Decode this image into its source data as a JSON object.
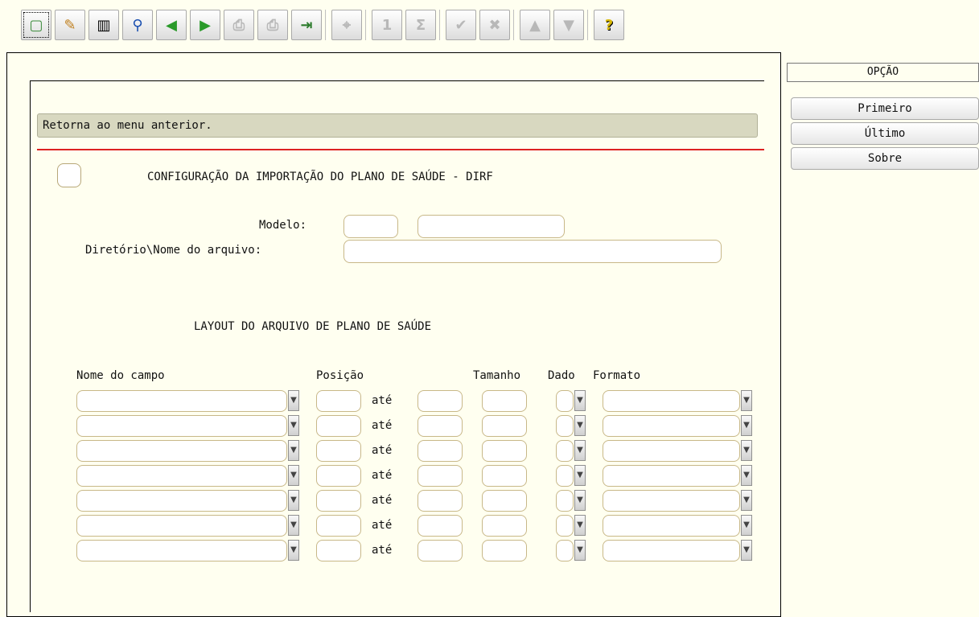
{
  "toolbar": {
    "buttons": [
      {
        "icon": "new-document-icon",
        "glyph": "▢"
      },
      {
        "icon": "edit-pencil-icon",
        "glyph": "✎"
      },
      {
        "icon": "trash-icon",
        "glyph": "🗑"
      },
      {
        "icon": "search-icon",
        "glyph": "🔍"
      },
      {
        "icon": "previous-icon",
        "glyph": "◀"
      },
      {
        "icon": "next-icon",
        "glyph": "▶"
      },
      {
        "icon": "print-icon",
        "glyph": "⎙"
      },
      {
        "icon": "print-preview-icon",
        "glyph": "⎙"
      },
      {
        "icon": "exit-door-icon",
        "glyph": "⇥"
      },
      {
        "icon": "binoculars-icon",
        "glyph": "⌖"
      },
      {
        "icon": "single-record-icon",
        "glyph": "1"
      },
      {
        "icon": "list-icon",
        "glyph": "Σ"
      },
      {
        "icon": "confirm-check-icon",
        "glyph": "✔"
      },
      {
        "icon": "cancel-x-icon",
        "glyph": "✖"
      },
      {
        "icon": "move-up-icon",
        "glyph": "▲"
      },
      {
        "icon": "move-down-icon",
        "glyph": "▼"
      },
      {
        "icon": "help-icon",
        "glyph": "?"
      }
    ]
  },
  "message": "Retorna ao menu anterior.",
  "title": "CONFIGURAÇÃO DA IMPORTAÇÃO DO PLANO DE SAÚDE - DIRF",
  "form": {
    "modelo_label": "Modelo:",
    "modelo_code": "",
    "modelo_desc": "",
    "arquivo_label": "Diretório\\Nome do arquivo:",
    "arquivo_value": ""
  },
  "layout": {
    "title": "LAYOUT DO ARQUIVO DE PLANO DE SAÚDE",
    "col_nome": "Nome do campo",
    "col_posicao": "Posição",
    "col_tamanho": "Tamanho",
    "col_dado": "Dado",
    "col_formato": "Formato",
    "ate": "até",
    "rows": [
      {
        "nome": "",
        "pos_ini": "",
        "pos_fim": "",
        "tamanho": "",
        "dado": "",
        "formato": ""
      },
      {
        "nome": "",
        "pos_ini": "",
        "pos_fim": "",
        "tamanho": "",
        "dado": "",
        "formato": ""
      },
      {
        "nome": "",
        "pos_ini": "",
        "pos_fim": "",
        "tamanho": "",
        "dado": "",
        "formato": ""
      },
      {
        "nome": "",
        "pos_ini": "",
        "pos_fim": "",
        "tamanho": "",
        "dado": "",
        "formato": ""
      },
      {
        "nome": "",
        "pos_ini": "",
        "pos_fim": "",
        "tamanho": "",
        "dado": "",
        "formato": ""
      },
      {
        "nome": "",
        "pos_ini": "",
        "pos_fim": "",
        "tamanho": "",
        "dado": "",
        "formato": ""
      },
      {
        "nome": "",
        "pos_ini": "",
        "pos_fim": "",
        "tamanho": "",
        "dado": "",
        "formato": ""
      }
    ]
  },
  "side_menu": {
    "header": "OPÇÃO",
    "items": [
      "Primeiro",
      "Último",
      "Sobre"
    ]
  }
}
